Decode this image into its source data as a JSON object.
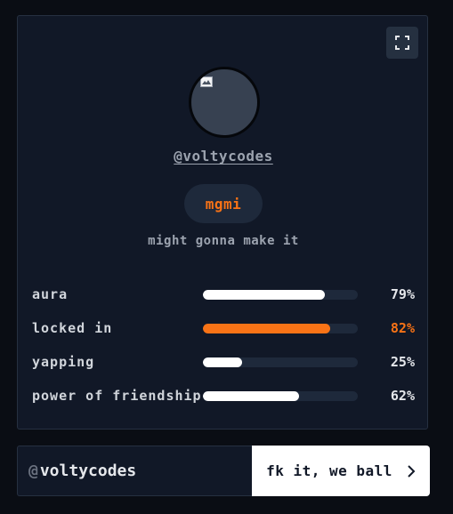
{
  "profile": {
    "username": "@voltycodes",
    "badge": "mgmi",
    "subtitle": "might gonna make it"
  },
  "stats": [
    {
      "label": "aura",
      "value": "79%",
      "level": 0.79,
      "accent": false
    },
    {
      "label": "locked in",
      "value": "82%",
      "level": 0.82,
      "accent": true
    },
    {
      "label": "yapping",
      "value": "25%",
      "level": 0.25,
      "accent": false
    },
    {
      "label": "power of friendship",
      "value": "62%",
      "level": 0.62,
      "accent": false
    }
  ],
  "form": {
    "prefix": "@",
    "handle_value": "voltycodes",
    "submit_label": "fk it, we ball"
  },
  "icons": {
    "fullscreen": "fullscreen-icon",
    "submit": "chevron-right-icon",
    "avatar": "broken-image-icon"
  },
  "colors": {
    "accent": "#f97316",
    "card_background": "#111827",
    "page_background": "#0a0d14",
    "bar_fill": "#ffffff",
    "bar_track": "#1e293b"
  }
}
